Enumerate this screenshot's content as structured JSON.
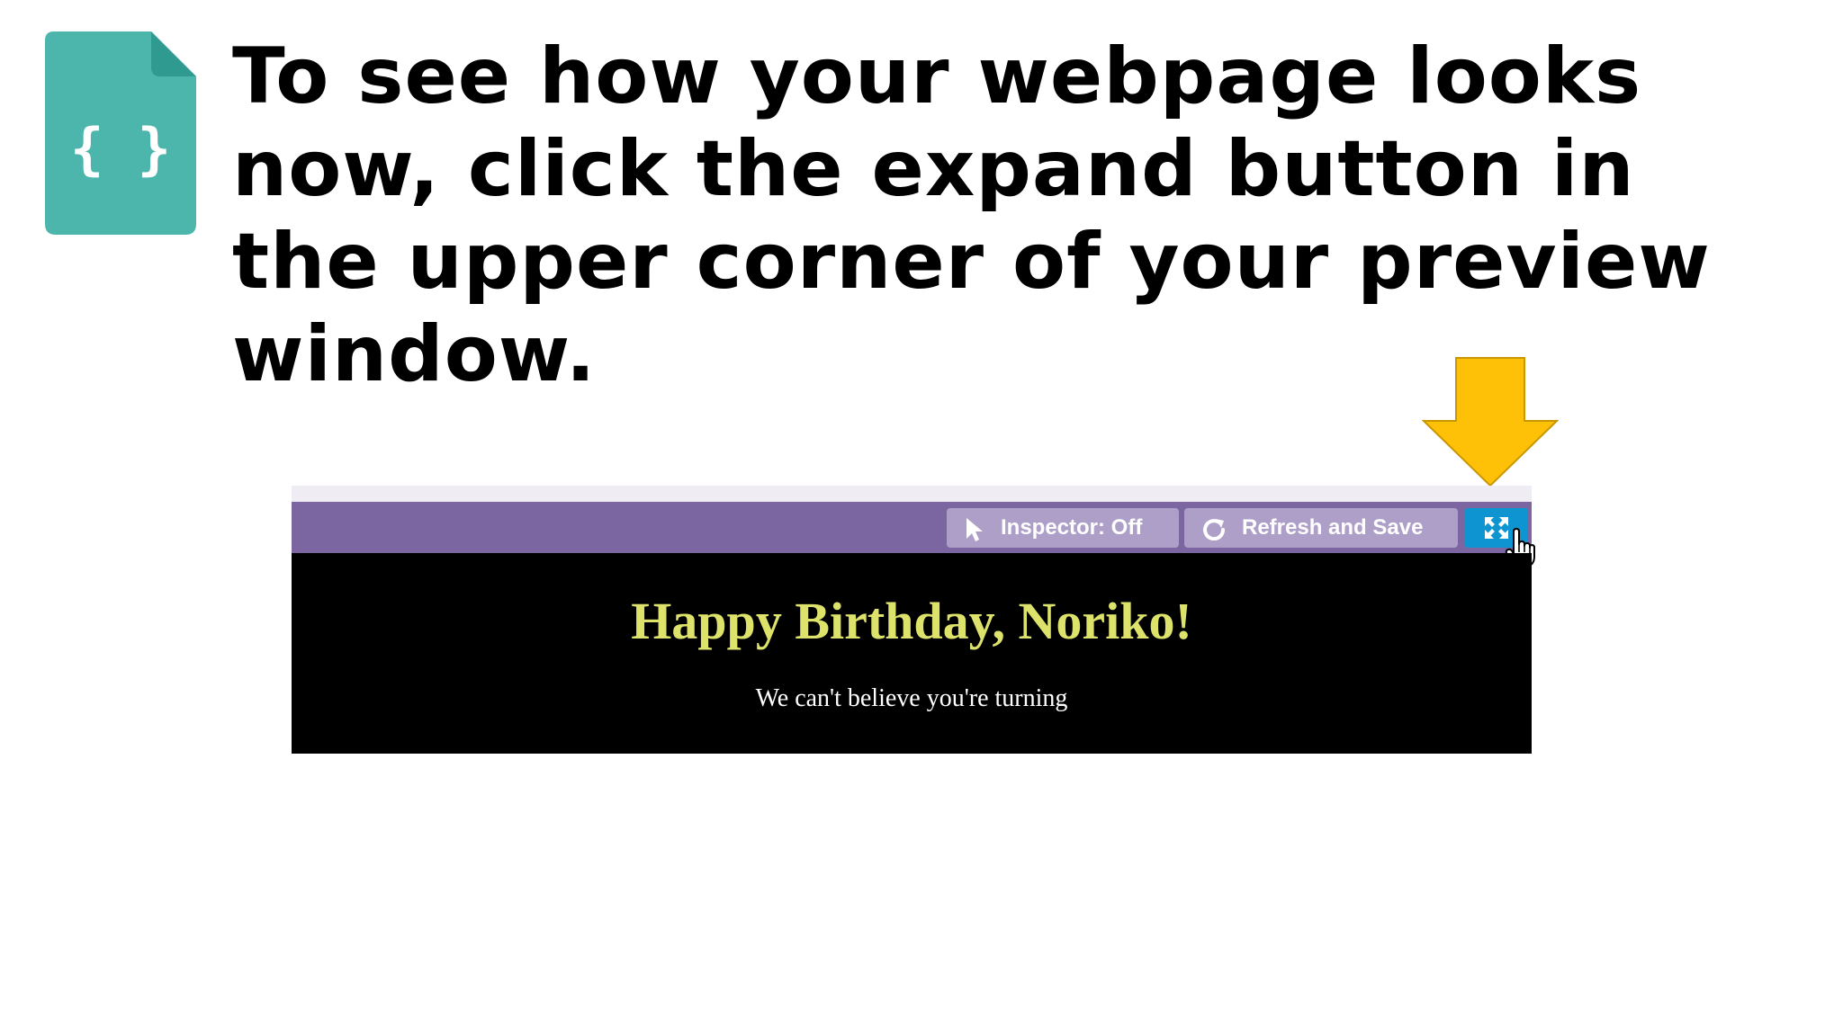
{
  "instruction": {
    "text": "To see how your webpage looks now, click the expand button in the upper corner of your preview window."
  },
  "icons": {
    "file": "json-file-icon",
    "file_glyph": "{ }",
    "arrow": "down-arrow-icon",
    "cursor": "hand-pointer-cursor-icon"
  },
  "preview": {
    "toolbar": {
      "inspector_label": "Inspector: Off",
      "refresh_label": "Refresh and Save",
      "expand_icon": "expand-icon"
    },
    "page": {
      "heading": "Happy Birthday, Noriko!",
      "paragraph": "We can't believe you're turning"
    }
  },
  "colors": {
    "file_icon": "#4db6ac",
    "arrow": "#ffc107",
    "toolbar": "#7b66a2",
    "toolbar_button": "#ad9fc8",
    "expand_button": "#0e94d1",
    "heading": "#dde36a",
    "viewport_bg": "#000000"
  }
}
